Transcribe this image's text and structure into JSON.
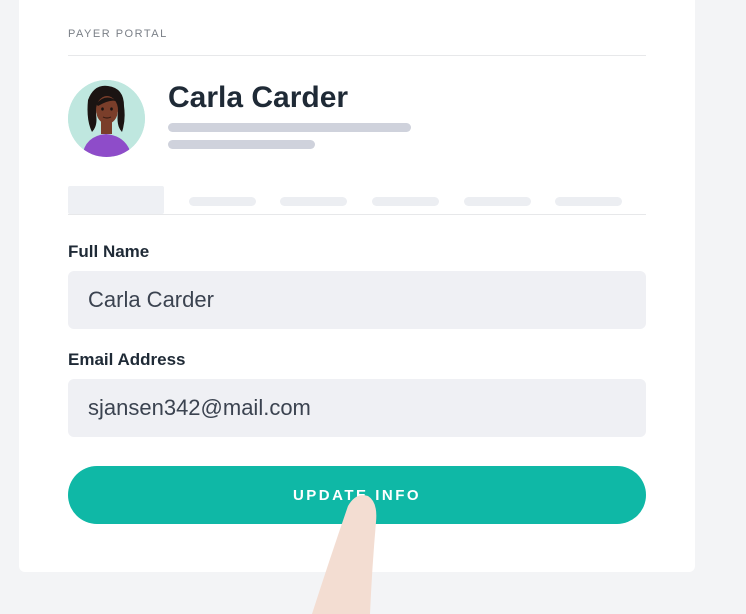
{
  "portal": {
    "label": "PAYER PORTAL"
  },
  "profile": {
    "name": "Carla Carder",
    "avatar_icon": "person-avatar-icon"
  },
  "form": {
    "full_name_label": "Full Name",
    "full_name_value": "Carla Carder",
    "email_label": "Email Address",
    "email_value": "sjansen342@mail.com",
    "submit_label": "UPDATE INFO"
  },
  "colors": {
    "accent": "#0fb8a6",
    "input_bg": "#eff0f4",
    "placeholder_bar": "#cfd2dc",
    "avatar_bg": "#bfe7df",
    "avatar_shirt": "#8e4cc9"
  }
}
